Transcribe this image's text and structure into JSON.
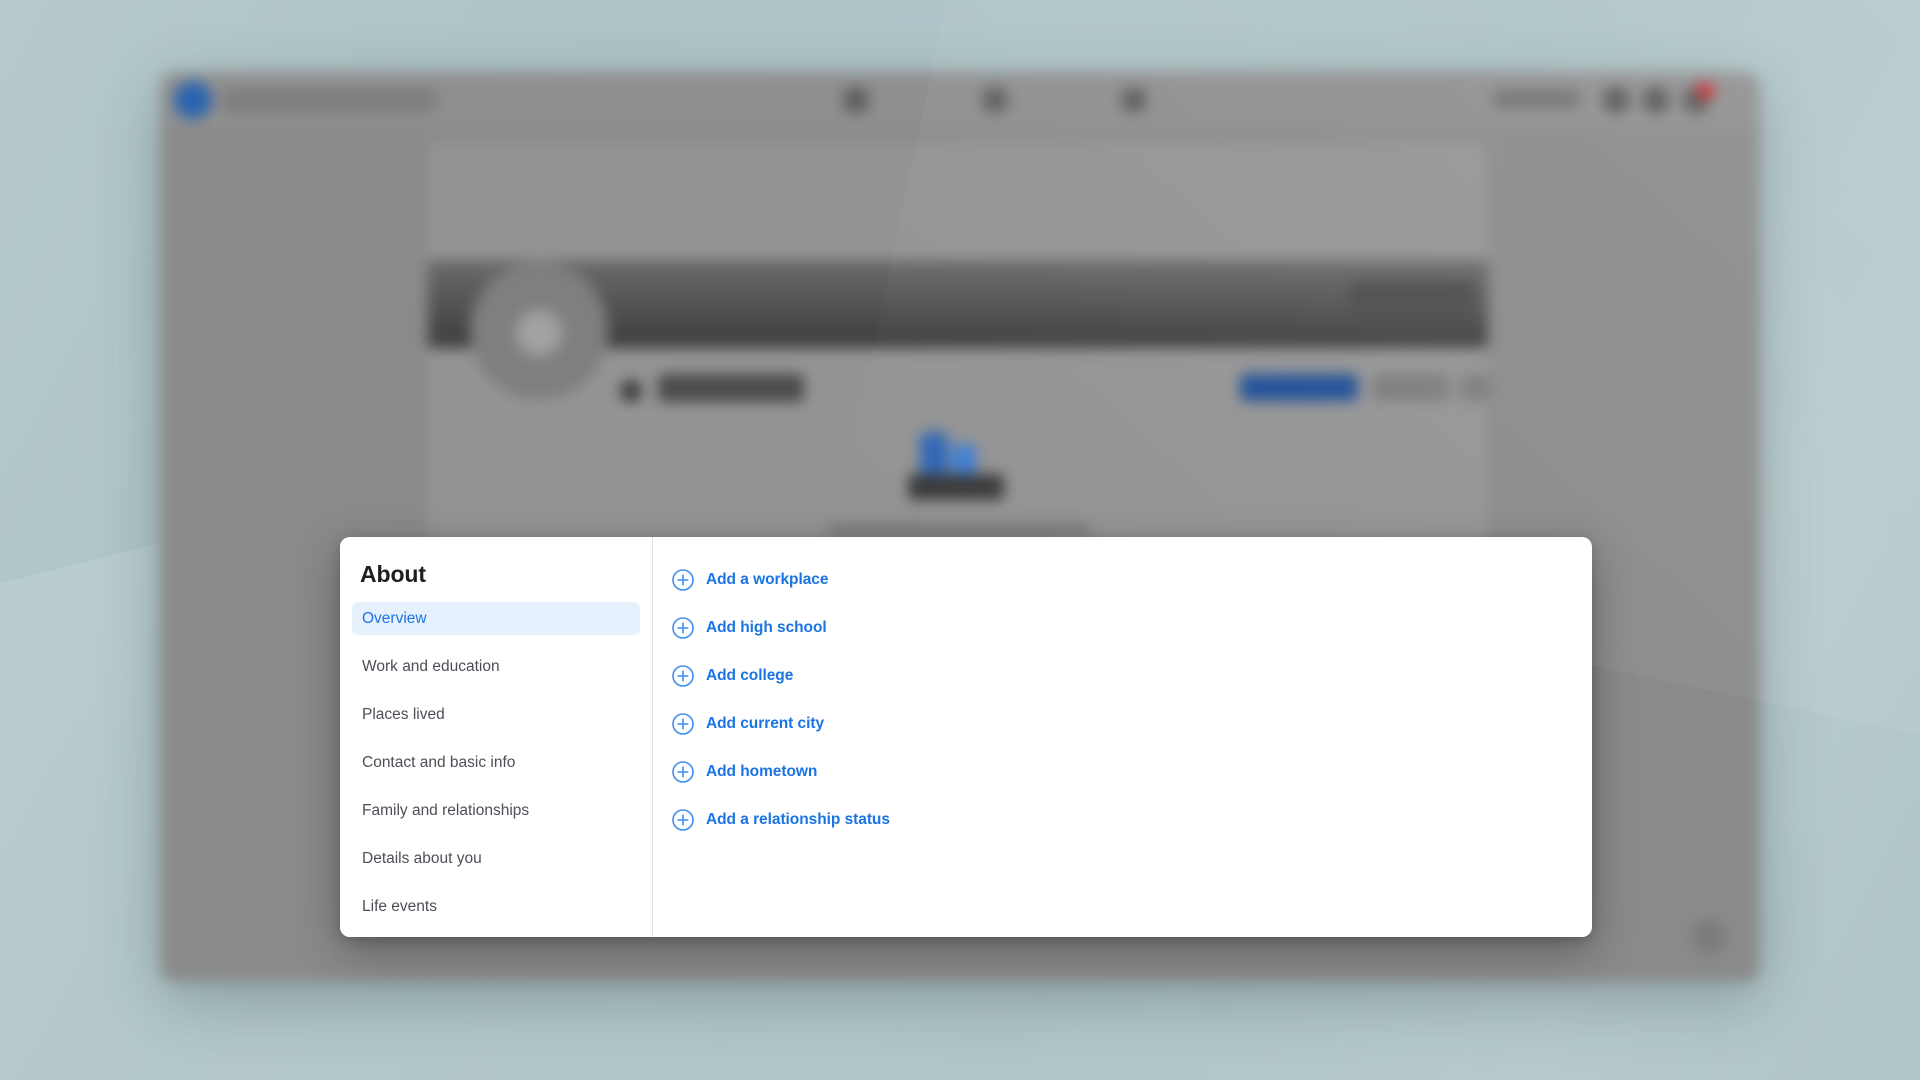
{
  "background_page": {
    "app": "facebook",
    "description": "Blurred Facebook profile page behind the modal",
    "colors": {
      "desktop_backdrop": "#b2c7ca",
      "window_chrome": "#8a8a8a",
      "brand_blue": "#1b74e4",
      "notification_badge": "#d6202a"
    }
  },
  "modal": {
    "title": "About",
    "nav": {
      "items": [
        {
          "label": "Overview",
          "active": true
        },
        {
          "label": "Work and education",
          "active": false
        },
        {
          "label": "Places lived",
          "active": false
        },
        {
          "label": "Contact and basic info",
          "active": false
        },
        {
          "label": "Family and relationships",
          "active": false
        },
        {
          "label": "Details about you",
          "active": false
        },
        {
          "label": "Life events",
          "active": false
        }
      ]
    },
    "content": {
      "add_actions": [
        {
          "label": "Add a workplace",
          "icon": "plus-circle-icon"
        },
        {
          "label": "Add high school",
          "icon": "plus-circle-icon"
        },
        {
          "label": "Add college",
          "icon": "plus-circle-icon"
        },
        {
          "label": "Add current city",
          "icon": "plus-circle-icon"
        },
        {
          "label": "Add hometown",
          "icon": "plus-circle-icon"
        },
        {
          "label": "Add a relationship status",
          "icon": "plus-circle-icon"
        }
      ]
    },
    "colors": {
      "link_blue": "#1b74e4",
      "active_pill_bg": "#e7f0fd",
      "nav_text": "#4b4f56",
      "title_text": "#1c1e21",
      "divider": "#dfe1e5"
    }
  }
}
